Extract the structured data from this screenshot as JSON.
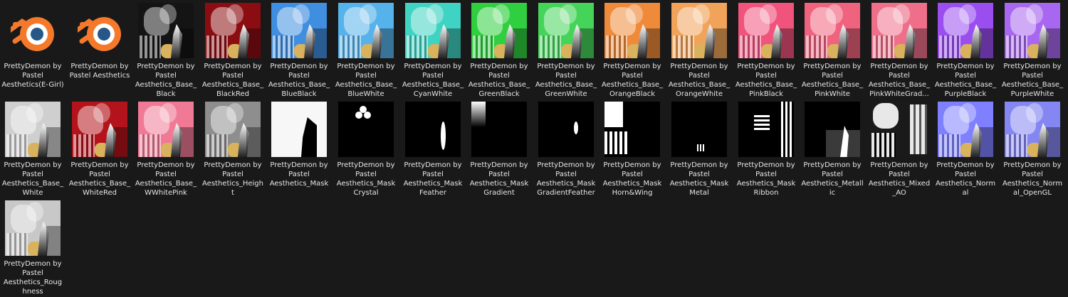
{
  "files": [
    {
      "label": "PrettyDemon by Pastel Aesthetics(E-Girl)",
      "kind": "blend"
    },
    {
      "label": "PrettyDemon by Pastel Aesthetics",
      "kind": "blend"
    },
    {
      "label": "PrettyDemon by Pastel Aesthetics_Base_ Black",
      "kind": "texture",
      "color": "#141414"
    },
    {
      "label": "PrettyDemon by Pastel Aesthetics_Base_ BlackRed",
      "kind": "texture",
      "color": "#8b0d12"
    },
    {
      "label": "PrettyDemon by Pastel Aesthetics_Base_ BlueBlack",
      "kind": "texture",
      "color": "#3f8ee0"
    },
    {
      "label": "PrettyDemon by Pastel Aesthetics_Base_ BlueWhite",
      "kind": "texture",
      "color": "#55b2ea"
    },
    {
      "label": "PrettyDemon by Pastel Aesthetics_Base_ CyanWhite",
      "kind": "texture",
      "color": "#3fd3c3"
    },
    {
      "label": "PrettyDemon by Pastel Aesthetics_Base_ GreenBlack",
      "kind": "texture",
      "color": "#2fcf3f"
    },
    {
      "label": "PrettyDemon by Pastel Aesthetics_Base_ GreenWhite",
      "kind": "texture",
      "color": "#45d45a"
    },
    {
      "label": "PrettyDemon by Pastel Aesthetics_Base_ OrangeBlack",
      "kind": "texture",
      "color": "#ef8a3a"
    },
    {
      "label": "PrettyDemon by Pastel Aesthetics_Base_ OrangeWhite",
      "kind": "texture",
      "color": "#f1a35a"
    },
    {
      "label": "PrettyDemon by Pastel Aesthetics_Base_ PinkBlack",
      "kind": "texture",
      "color": "#f0537c"
    },
    {
      "label": "PrettyDemon by Pastel Aesthetics_Base_ PinkWhite",
      "kind": "texture",
      "color": "#f0637f"
    },
    {
      "label": "PrettyDemon by Pastel Aesthetics_Base_ PinkWhiteGrad...",
      "kind": "texture",
      "color": "#ef6f8a"
    },
    {
      "label": "PrettyDemon by Pastel Aesthetics_Base_ PurpleBlack",
      "kind": "texture",
      "color": "#9a4ef0"
    },
    {
      "label": "PrettyDemon by Pastel Aesthetics_Base_ PurpleWhite",
      "kind": "texture",
      "color": "#a867f0"
    },
    {
      "label": "PrettyDemon by Pastel Aesthetics_Base_ White",
      "kind": "texture",
      "color": "#cfcfcf"
    },
    {
      "label": "PrettyDemon by Pastel Aesthetics_Base_ WhiteRed",
      "kind": "texture",
      "color": "#b3131a"
    },
    {
      "label": "PrettyDemon by Pastel Aesthetics_Base_ WWhitePink",
      "kind": "texture",
      "color": "#f07a96"
    },
    {
      "label": "PrettyDemon by Pastel Aesthetics_Heigh t",
      "kind": "texture",
      "color": "#8e8e8e"
    },
    {
      "label": "PrettyDemon by Pastel Aesthetics_Mask",
      "kind": "mask",
      "bg": "#f7f7f7",
      "fg": "#000000"
    },
    {
      "label": "PrettyDemon by Pastel Aesthetics_Mask Crystal",
      "kind": "mask",
      "bg": "#000000",
      "fg": "#ffffff"
    },
    {
      "label": "PrettyDemon by Pastel Aesthetics_Mask Feather",
      "kind": "mask",
      "bg": "#000000",
      "fg": "#ffffff"
    },
    {
      "label": "PrettyDemon by Pastel Aesthetics_Mask Gradient",
      "kind": "mask",
      "bg": "#000000",
      "fg": "#ffffff"
    },
    {
      "label": "PrettyDemon by Pastel Aesthetics_Mask GradientFeather",
      "kind": "mask",
      "bg": "#000000",
      "fg": "#ffffff"
    },
    {
      "label": "PrettyDemon by Pastel Aesthetics_Mask Horn&Wing",
      "kind": "mask",
      "bg": "#000000",
      "fg": "#ffffff"
    },
    {
      "label": "PrettyDemon by Pastel Aesthetics_Mask Metal",
      "kind": "mask",
      "bg": "#000000",
      "fg": "#ffffff"
    },
    {
      "label": "PrettyDemon by Pastel Aesthetics_Mask Ribbon",
      "kind": "mask",
      "bg": "#000000",
      "fg": "#ffffff"
    },
    {
      "label": "PrettyDemon by Pastel Aesthetics_Metall ic",
      "kind": "mask",
      "bg": "#000000",
      "fg": "#3a3a3a"
    },
    {
      "label": "PrettyDemon by Pastel Aesthetics_Mixed _AO",
      "kind": "mask",
      "bg": "#1a1a1a",
      "fg": "#e8e8e8"
    },
    {
      "label": "PrettyDemon by Pastel Aesthetics_Norm al",
      "kind": "texture",
      "color": "#7f80ff"
    },
    {
      "label": "PrettyDemon by Pastel Aesthetics_Norm al_OpenGL",
      "kind": "texture",
      "color": "#8486f2"
    },
    {
      "label": "PrettyDemon by Pastel Aesthetics_Roug hness",
      "kind": "texture",
      "color": "#c8c8c8"
    }
  ]
}
